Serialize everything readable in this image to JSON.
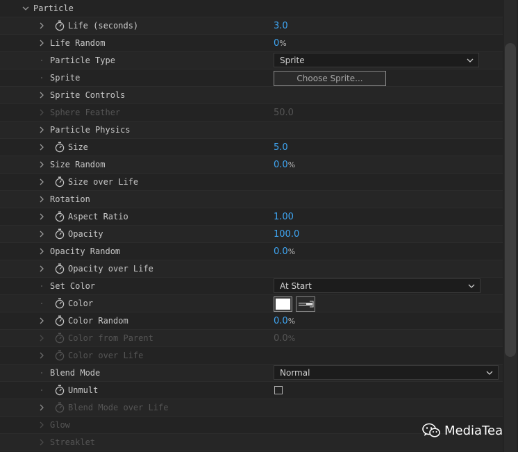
{
  "section": {
    "title": "Particle"
  },
  "rows": [
    {
      "label": "Life (seconds)",
      "value": "3.0",
      "unit": ""
    },
    {
      "label": "Life Random",
      "value": "0",
      "unit": "%"
    },
    {
      "label": "Particle Type",
      "dropdown": "Sprite"
    },
    {
      "label": "Sprite",
      "button": "Choose Sprite..."
    },
    {
      "label": "Sprite Controls"
    },
    {
      "label": "Sphere Feather",
      "value": "50.0",
      "unit": ""
    },
    {
      "label": "Particle Physics"
    },
    {
      "label": "Size",
      "value": "5.0",
      "unit": ""
    },
    {
      "label": "Size Random",
      "value": "0.0",
      "unit": "%"
    },
    {
      "label": "Size over Life"
    },
    {
      "label": "Rotation"
    },
    {
      "label": "Aspect Ratio",
      "value": "1.00",
      "unit": ""
    },
    {
      "label": "Opacity",
      "value": "100.0",
      "unit": ""
    },
    {
      "label": "Opacity Random",
      "value": "0.0",
      "unit": "%"
    },
    {
      "label": "Opacity over Life"
    },
    {
      "label": "Set Color",
      "dropdown": "At Start"
    },
    {
      "label": "Color",
      "color": "#ffffff"
    },
    {
      "label": "Color Random",
      "value": "0.0",
      "unit": "%"
    },
    {
      "label": "Color from Parent",
      "value": "0.0",
      "unit": "%"
    },
    {
      "label": "Color over Life"
    },
    {
      "label": "Blend Mode",
      "dropdown": "Normal"
    },
    {
      "label": "Unmult",
      "checked": false
    },
    {
      "label": "Blend Mode over Life"
    },
    {
      "label": "Glow"
    },
    {
      "label": "Streaklet"
    }
  ],
  "watermark": {
    "text": "MediaTea"
  },
  "colors": {
    "value_blue": "#3fa7f5",
    "disabled": "#555555",
    "panel_bg": "#232323"
  }
}
